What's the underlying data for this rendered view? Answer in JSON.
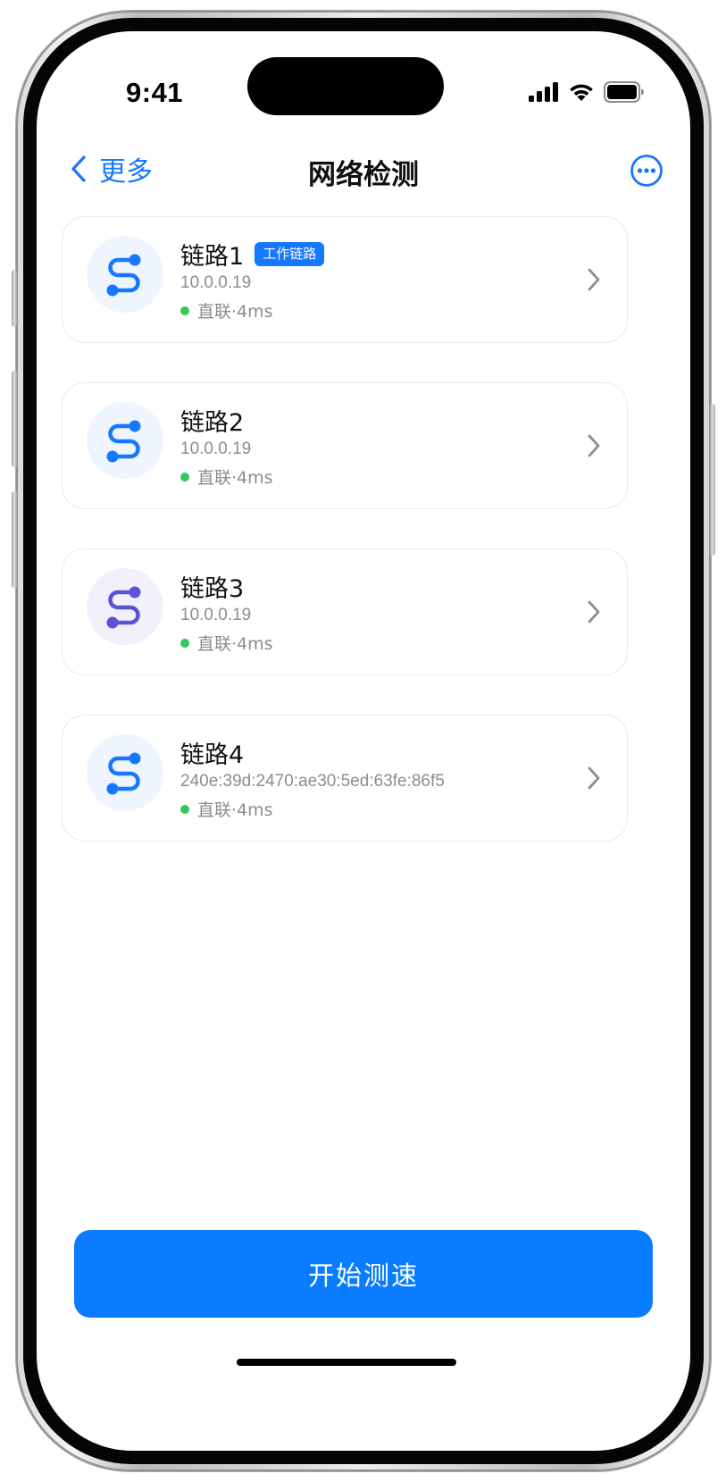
{
  "status_bar": {
    "time": "9:41"
  },
  "nav": {
    "back_label": "更多",
    "title": "网络检测"
  },
  "links": [
    {
      "name": "链路1",
      "badge": "工作链路",
      "address": "10.0.0.19",
      "status": "直联·4ms",
      "icon_color": "#1677ff",
      "icon_bg": "#eef5ff"
    },
    {
      "name": "链路2",
      "badge": "",
      "address": "10.0.0.19",
      "status": "直联·4ms",
      "icon_color": "#1677ff",
      "icon_bg": "#eef5ff"
    },
    {
      "name": "链路3",
      "badge": "",
      "address": "10.0.0.19",
      "status": "直联·4ms",
      "icon_color": "#5b52d6",
      "icon_bg": "#f2f1fb"
    },
    {
      "name": "链路4",
      "badge": "",
      "address": "240e:39d:2470:ae30:5ed:63fe:86f5",
      "status": "直联·4ms",
      "icon_color": "#1677ff",
      "icon_bg": "#eef5ff"
    }
  ],
  "primary_button": {
    "label": "开始测速"
  },
  "colors": {
    "accent": "#1677ff",
    "button": "#0a7cff",
    "status_ok": "#34c759"
  }
}
